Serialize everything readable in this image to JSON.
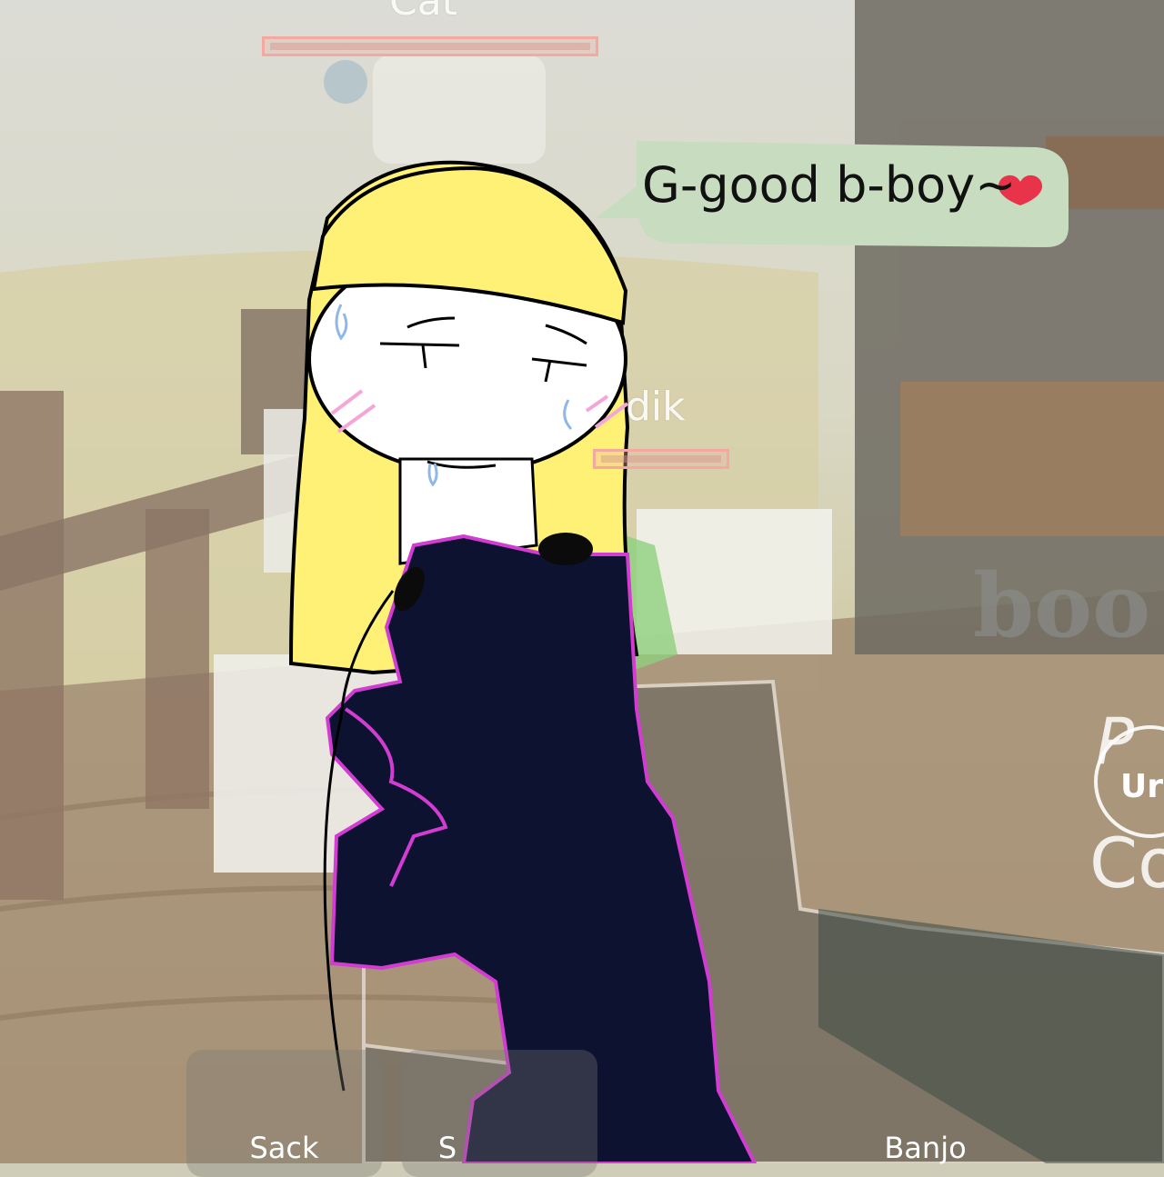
{
  "hud": {
    "name_tags": [
      {
        "text": "Cat"
      },
      {
        "text": "dik"
      }
    ],
    "health_bars": [
      {
        "owner": "Cat",
        "level": 1.0
      },
      {
        "owner": "dik",
        "level": 1.0
      }
    ],
    "world_sign": "boo",
    "side_button": {
      "label": "Ur",
      "top_text": "P",
      "bottom_text": "Co"
    },
    "hotbar": [
      {
        "label": "Sack"
      },
      {
        "label": "S"
      },
      {
        "label": "Banjo"
      }
    ]
  },
  "drawing": {
    "speech_text": "G-good b-boy~",
    "heart_icon": "heart-icon",
    "colors": {
      "hair": "#fff176",
      "bubble": "#c8dcc0",
      "cat_body": "#0c1230",
      "cat_outline": "#d23cd2",
      "blush": "#f4a6d8",
      "sweat": "#8fb8e8",
      "heart": "#e8334a"
    }
  }
}
